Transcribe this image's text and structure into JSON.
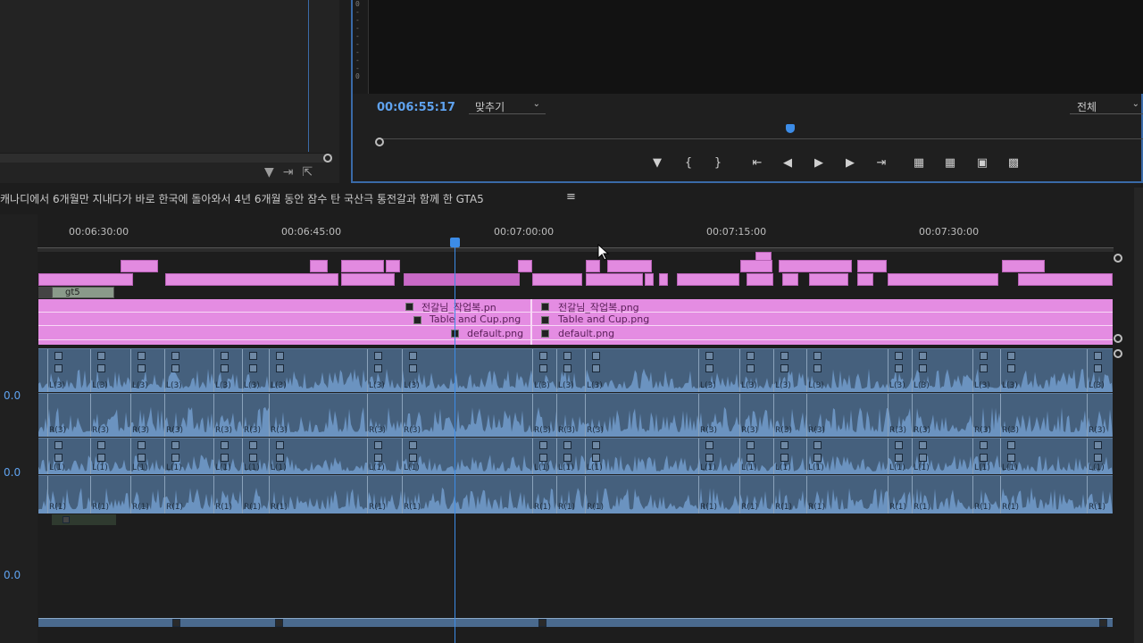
{
  "monitor": {
    "timecode": "00:06:55:17",
    "fit_select": "맞추기",
    "resolution_select": "전체",
    "vu_scale": [
      "0",
      "-",
      "-",
      "-",
      "-",
      "-",
      "-",
      "-",
      "-",
      "0"
    ]
  },
  "sequence": {
    "title": "캐나디에서 6개월만 지내다가 바로 한국에 돌아와서 4년 6개월 동안 잠수 탄 국산극 통전갈과 함께 한 GTA5",
    "menu_icon": "hamburger-icon"
  },
  "timeline": {
    "ruler_labels": [
      "00:06:30:00",
      "00:06:45:00",
      "00:07:00:00",
      "00:07:15:00",
      "00:07:30:00"
    ],
    "track_db": [
      "0.0",
      "0.0",
      "0.0"
    ],
    "nested_clip_label": "gt5",
    "clips_left": [
      "전갈님_작업복.pn",
      "Table and Cup.png",
      "default.png"
    ],
    "clips_right": [
      "전갈님_작업복.png",
      "Table and Cup.png",
      "default.png"
    ],
    "audio_labels": {
      "L3": "L(3)",
      "R3": "R(3)",
      "L1": "L(1)",
      "R1": "R(1)"
    }
  },
  "colors": {
    "accent": "#3c8ce7",
    "video_clip": "#e28ae0",
    "audio_clip": "#45607d"
  }
}
